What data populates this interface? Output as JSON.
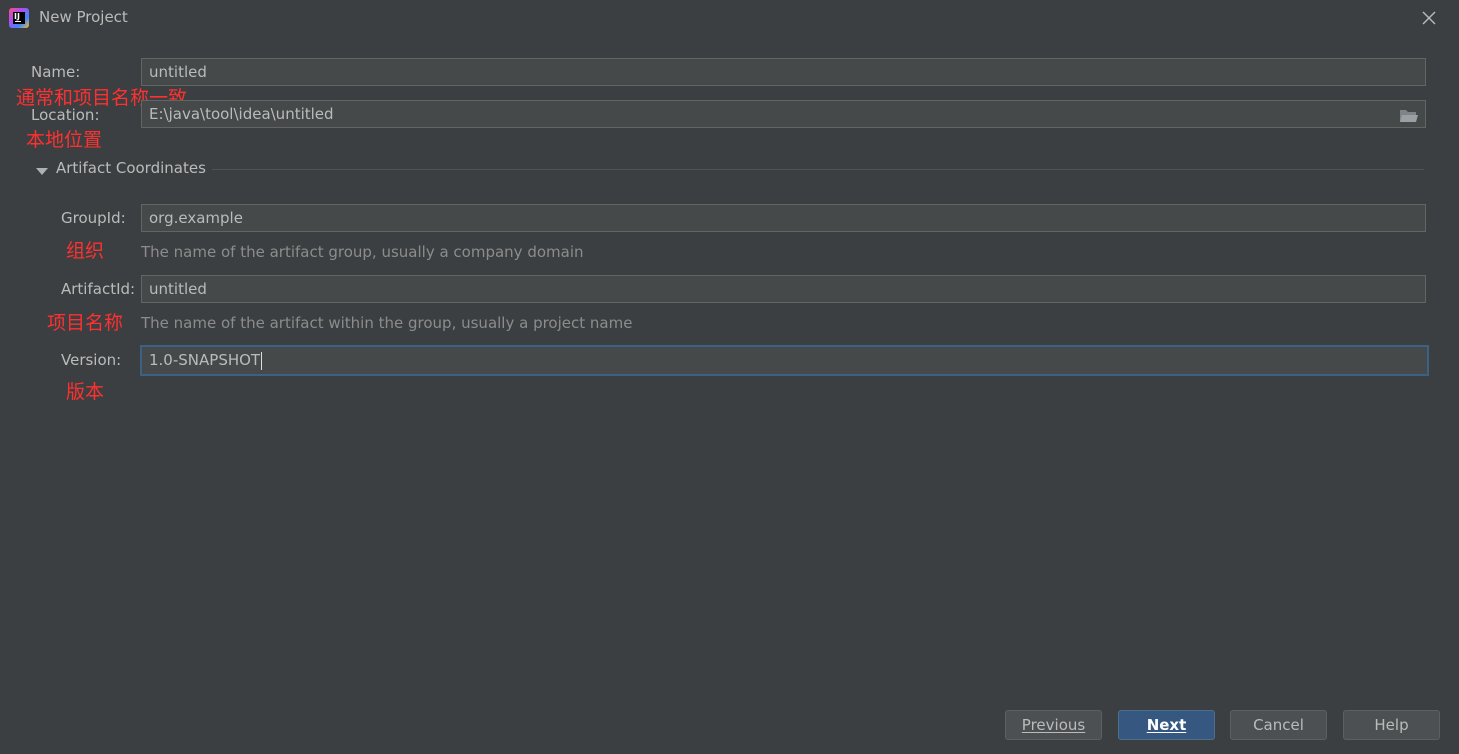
{
  "window": {
    "title": "New Project",
    "icon": "intellij-idea-icon",
    "icon_text": "IJ"
  },
  "form": {
    "name": {
      "label": "Name:",
      "value": "untitled"
    },
    "location": {
      "label": "Location:",
      "value": "E:\\java\\tool\\idea\\untitled"
    },
    "section": {
      "title": "Artifact Coordinates",
      "expanded": true
    },
    "group_id": {
      "label": "GroupId:",
      "value": "org.example",
      "hint": "The name of the artifact group, usually a company domain"
    },
    "artifact_id": {
      "label": "ArtifactId:",
      "value": "untitled",
      "hint": "The name of the artifact within the group, usually a project name"
    },
    "version": {
      "label": "Version:",
      "value": "1.0-SNAPSHOT",
      "focused": true
    }
  },
  "annotations": {
    "name_note": "通常和项目名称一致",
    "location_note": "本地位置",
    "group_note": "组织",
    "artifact_note": "项目名称",
    "version_note": "版本"
  },
  "buttons": {
    "previous": "Previous",
    "next": "Next",
    "cancel": "Cancel",
    "help": "Help"
  },
  "colors": {
    "background": "#3c3f41",
    "field_background": "#45494a",
    "primary_button": "#365880",
    "annotation": "#ff3030",
    "focus_border": "#3d6185"
  }
}
